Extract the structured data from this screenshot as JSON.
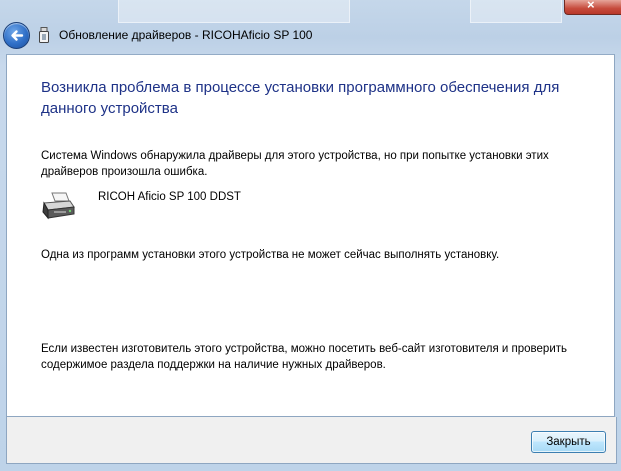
{
  "window": {
    "title": "Обновление драйверов - RICOHAficio SP 100"
  },
  "content": {
    "heading": "Возникла проблема в процессе установки программного обеспечения для данного устройства",
    "description": "Система Windows обнаружила драйверы для этого устройства, но при попытке установки этих драйверов произошла ошибка.",
    "device_name": "RICOH Aficio SP 100 DDST",
    "status_message": "Одна из программ установки этого устройства не может сейчас выполнять установку.",
    "hint": "Если известен изготовитель этого устройства, можно посетить веб-сайт изготовителя и проверить содержимое раздела поддержки на наличие нужных драйверов."
  },
  "footer": {
    "close_label": "Закрыть"
  },
  "icons": {
    "back": "back-arrow-icon",
    "device": "usb-device-icon",
    "printer": "printer-icon",
    "window_close": "close-icon"
  },
  "colors": {
    "heading": "#1e3287",
    "frame": "#c5d7ea",
    "button_border": "#3c7fb1"
  }
}
